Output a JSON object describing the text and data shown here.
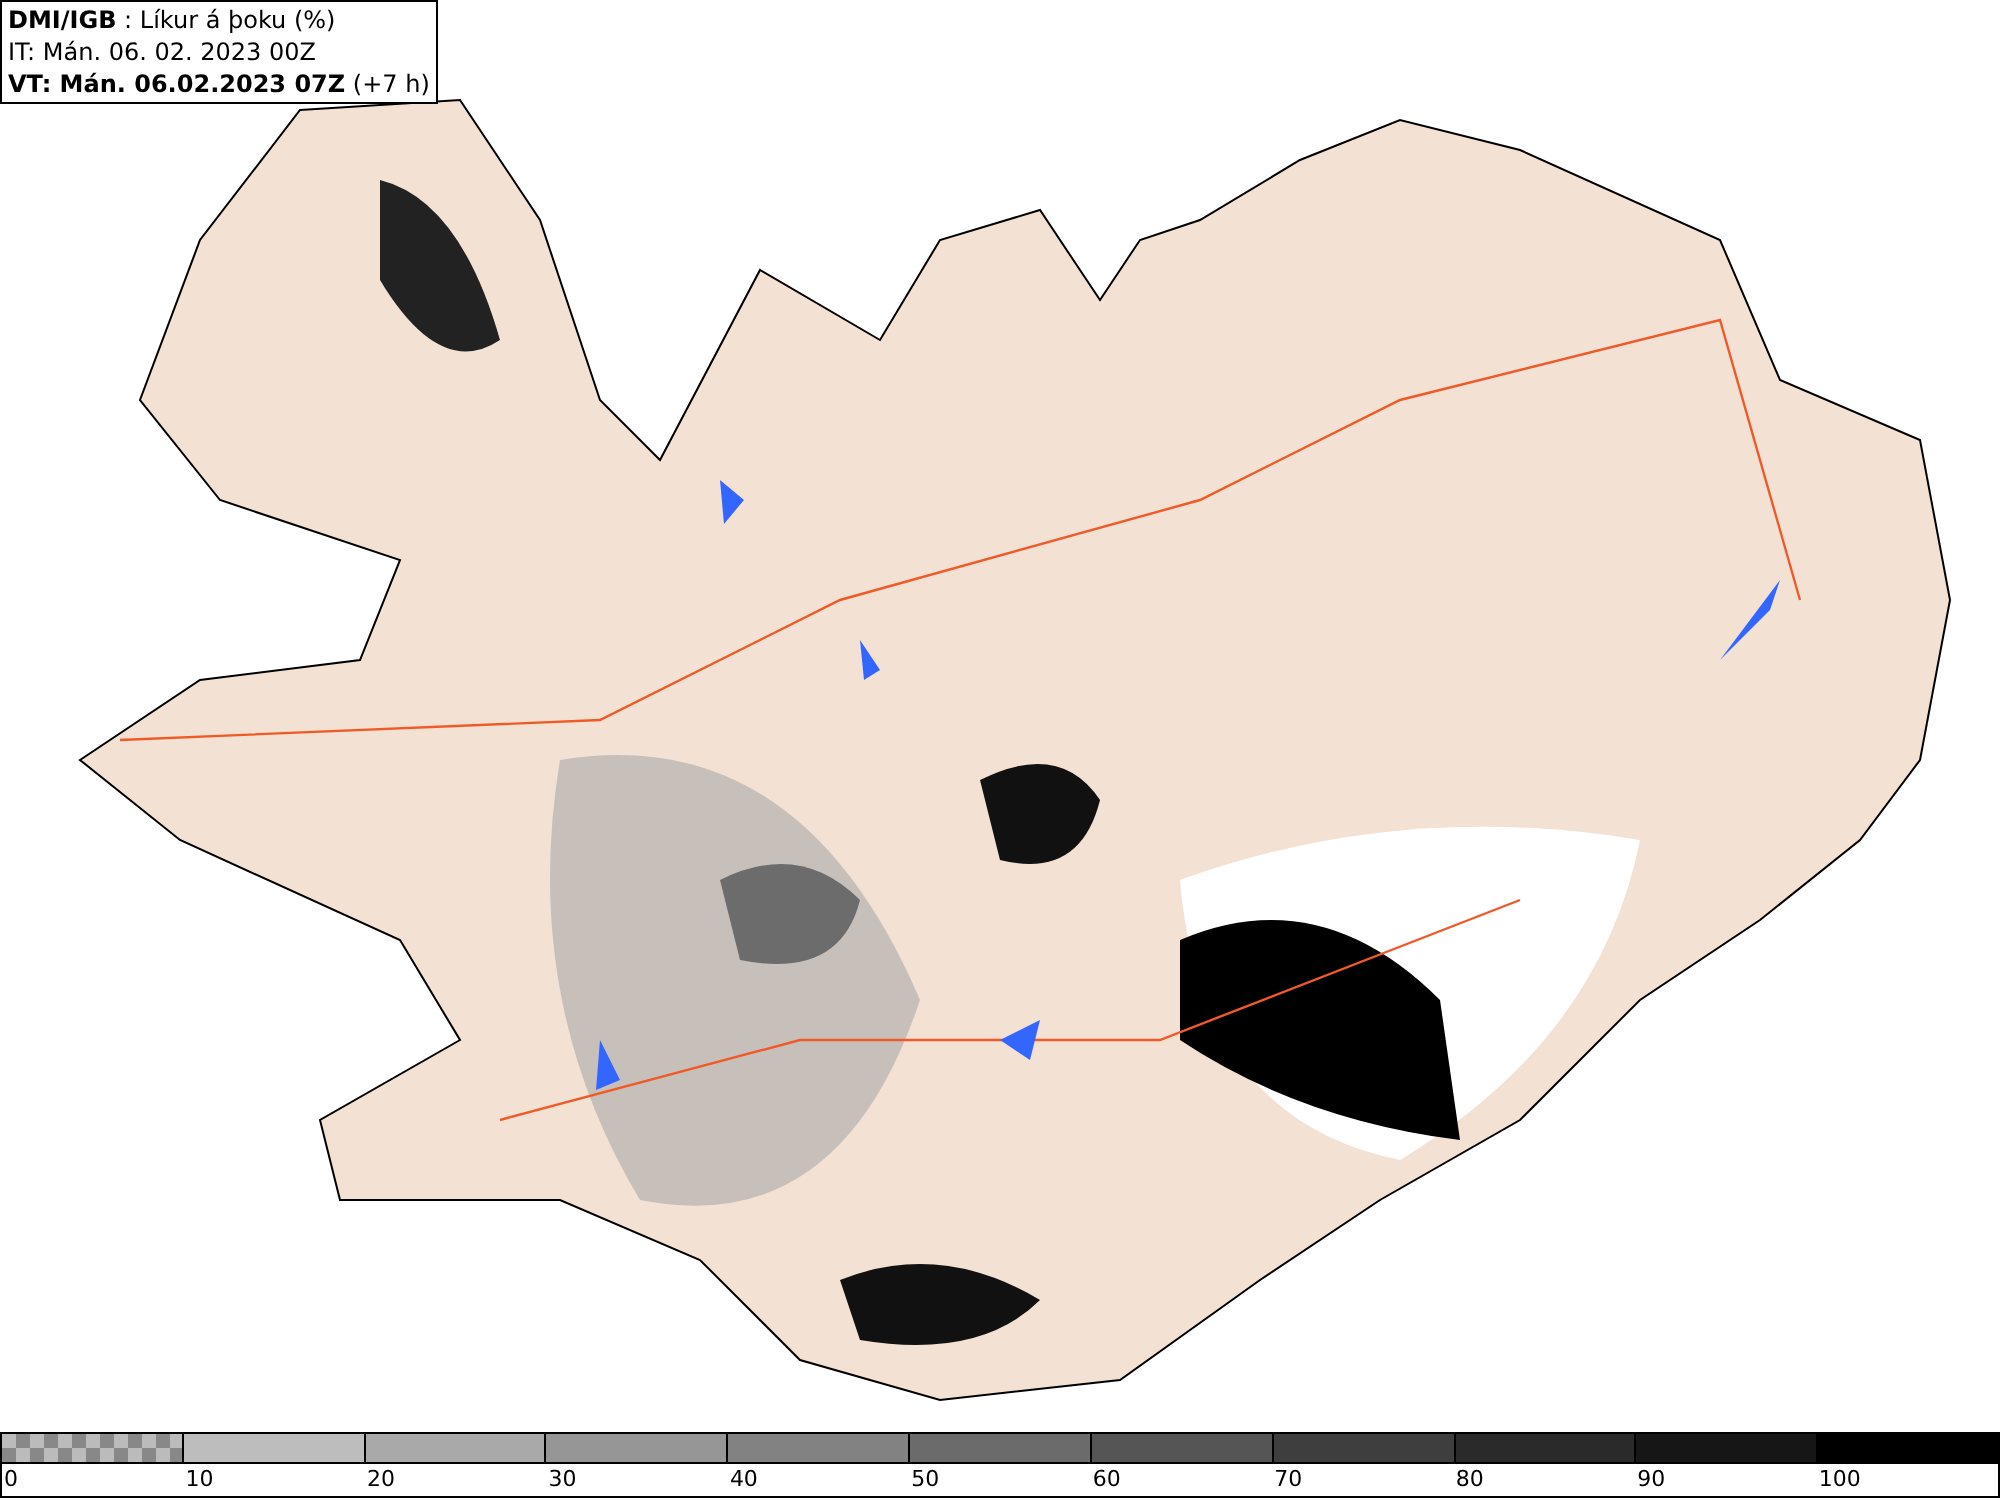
{
  "header": {
    "title": "**DMI/IGB** : Líkur á þoku (%)",
    "issue_time": "IT: Mán. 06. 02. 2023 00Z",
    "valid_time": "**VT: Mán. 06.02.2023 07Z** (+7 h)"
  },
  "legend": [
    {
      "kind": "checker",
      "color": "#888888",
      "label": "0"
    },
    {
      "kind": "solid",
      "color": "#bdbdbd",
      "label": "10"
    },
    {
      "kind": "solid",
      "color": "#a9a9a9",
      "label": "20"
    },
    {
      "kind": "solid",
      "color": "#969696",
      "label": "30"
    },
    {
      "kind": "solid",
      "color": "#828282",
      "label": "40"
    },
    {
      "kind": "solid",
      "color": "#6b6b6b",
      "label": "50"
    },
    {
      "kind": "solid",
      "color": "#555555",
      "label": "60"
    },
    {
      "kind": "solid",
      "color": "#3e3e3e",
      "label": "70"
    },
    {
      "kind": "solid",
      "color": "#2a2a2a",
      "label": "80"
    },
    {
      "kind": "solid",
      "color": "#161616",
      "label": "90"
    },
    {
      "kind": "solid",
      "color": "#000000",
      "label": "100"
    }
  ]
}
